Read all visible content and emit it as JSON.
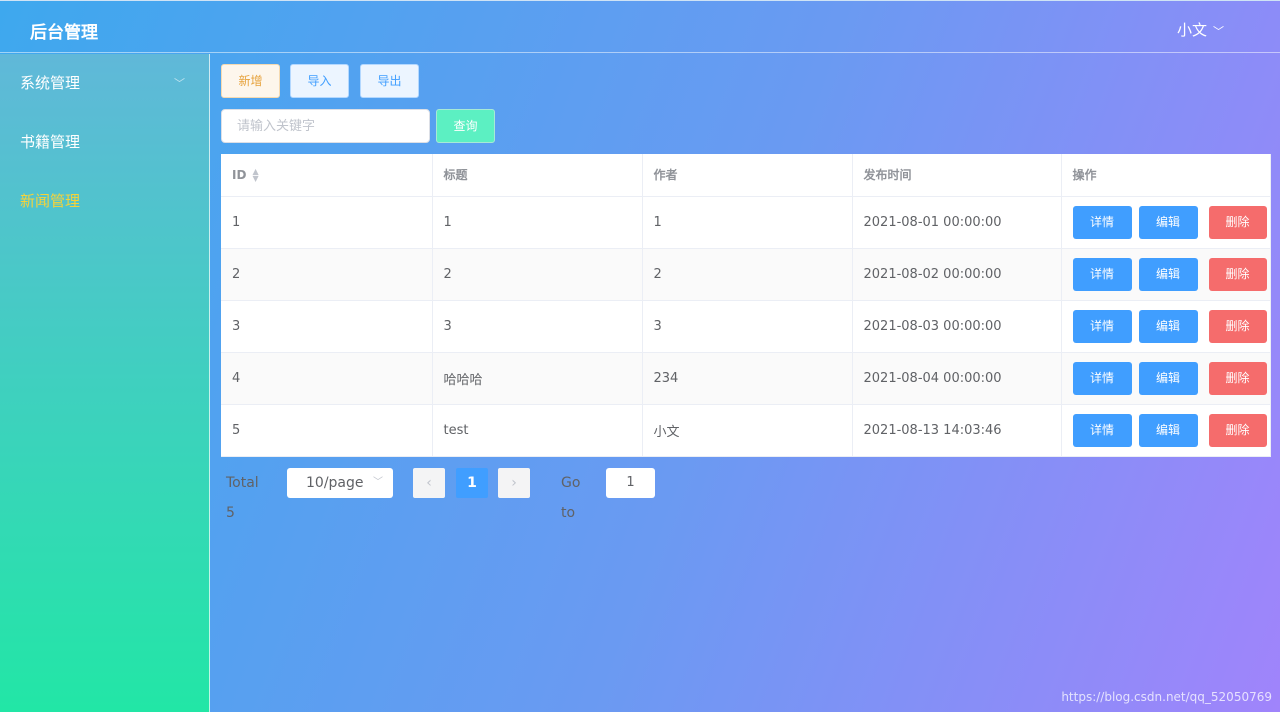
{
  "header": {
    "title": "后台管理",
    "user": "小文"
  },
  "sidebar": {
    "items": [
      {
        "label": "系统管理"
      },
      {
        "label": "书籍管理"
      },
      {
        "label": "新闻管理"
      }
    ]
  },
  "toolbar": {
    "add": "新增",
    "import": "导入",
    "export": "导出",
    "search_placeholder": "请输入关键字",
    "search_value": "",
    "query": "查询"
  },
  "table": {
    "headers": [
      "ID",
      "标题",
      "作者",
      "发布时间",
      "操作"
    ],
    "rows": [
      [
        "1",
        "1",
        "1",
        "2021-08-01 00:00:00"
      ],
      [
        "2",
        "2",
        "2",
        "2021-08-02 00:00:00"
      ],
      [
        "3",
        "3",
        "3",
        "2021-08-03 00:00:00"
      ],
      [
        "4",
        "哈哈哈",
        "234",
        "2021-08-04 00:00:00"
      ],
      [
        "5",
        "test",
        "小文",
        "2021-08-13 14:03:46"
      ]
    ],
    "actions": {
      "detail": "详情",
      "edit": "编辑",
      "delete": "删除"
    }
  },
  "pagination": {
    "total": "Total 5",
    "page_size": "10/page",
    "current": "1",
    "goto_label": "Go to",
    "goto_value": "1"
  },
  "watermark": "https://blog.csdn.net/qq_52050769"
}
